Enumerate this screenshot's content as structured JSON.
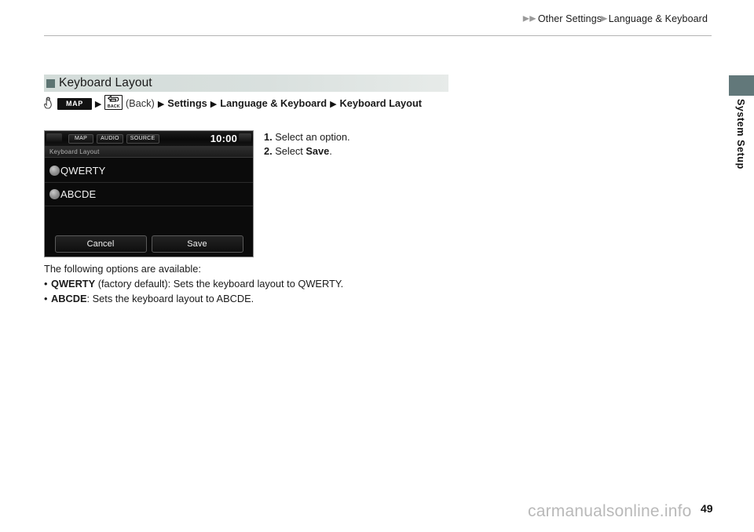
{
  "header": {
    "breadcrumb": {
      "lead_arrows": "▶▶",
      "item1": "Other Settings",
      "separator": "▶",
      "item2": "Language & Keyboard"
    }
  },
  "side_tab": {
    "label": "System Setup"
  },
  "section": {
    "title": "Keyboard Layout"
  },
  "path": {
    "hand_icon": "hand-pointer-icon",
    "map_button": "MAP",
    "arrow": "▶",
    "back_icon_label": "BACK",
    "back_text": "(Back)",
    "settings": "Settings",
    "language_keyboard": "Language & Keyboard",
    "keyboard_layout": "Keyboard Layout"
  },
  "device": {
    "buttons": {
      "map": "MAP",
      "audio": "AUDIO",
      "source": "SOURCE"
    },
    "clock": "10:00",
    "screen_title": "Keyboard Layout",
    "options": [
      {
        "label": "QWERTY"
      },
      {
        "label": "ABCDE"
      }
    ],
    "footer": {
      "cancel": "Cancel",
      "save": "Save"
    }
  },
  "steps": [
    {
      "num": "1.",
      "text": " Select an option."
    },
    {
      "num": "2.",
      "text_before": " Select ",
      "strong": "Save",
      "text_after": "."
    }
  ],
  "body": {
    "intro": "The following options are available:",
    "options": [
      {
        "bullet": "•",
        "name": "QWERTY",
        "desc": " (factory default): Sets the keyboard layout to QWERTY."
      },
      {
        "bullet": "•",
        "name": "ABCDE",
        "desc": ": Sets the keyboard layout to ABCDE."
      }
    ]
  },
  "footer": {
    "watermark": "carmanualsonline.info",
    "page_number": "49"
  },
  "colors": {
    "side_tab": "#62787a",
    "section_bar": "#d3dcd9",
    "section_bullet": "#5d7472",
    "rule": "#b4b4b4"
  }
}
